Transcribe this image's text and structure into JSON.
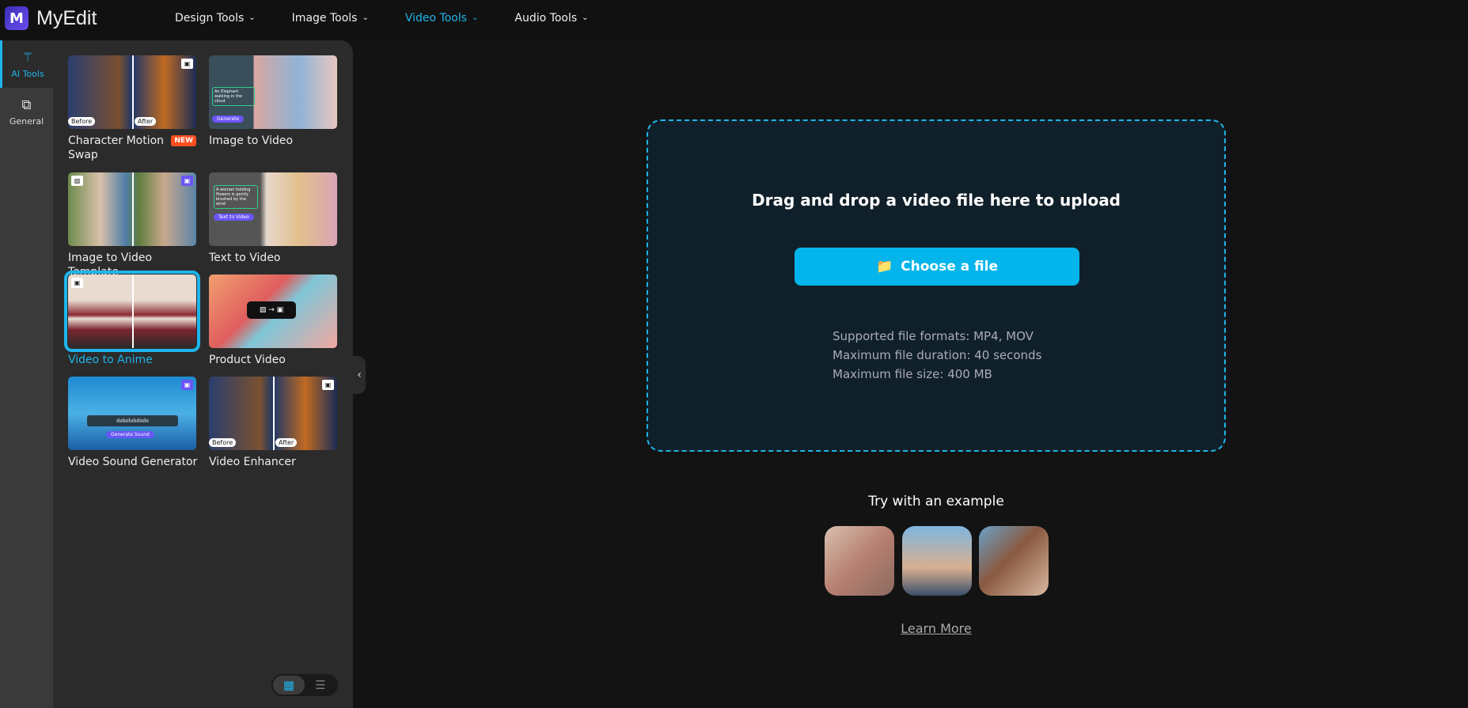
{
  "app": {
    "logo_letter": "M",
    "name": "MyEdit"
  },
  "nav": [
    {
      "label": "Design Tools"
    },
    {
      "label": "Image Tools"
    },
    {
      "label": "Video Tools",
      "active": true
    },
    {
      "label": "Audio Tools"
    }
  ],
  "rail": [
    {
      "label": "AI Tools",
      "icon": "magic-wand-icon",
      "active": true
    },
    {
      "label": "General",
      "icon": "layers-icon"
    }
  ],
  "tools": [
    {
      "title": "Character Motion Swap",
      "badge": "NEW",
      "tags": [
        "Before",
        "After"
      ]
    },
    {
      "title": "Image to Video",
      "overlay": "An Elephant walking in the cloud",
      "button": "Generate"
    },
    {
      "title": "Image to Video Template"
    },
    {
      "title": "Text to Video",
      "overlay": "A woman holding flowers is gently brushed by the wind",
      "button": "Text to Video"
    },
    {
      "title": "Video to Anime",
      "selected": true
    },
    {
      "title": "Product Video"
    },
    {
      "title": "Video Sound Generator",
      "button": "Generate Sound"
    },
    {
      "title": "Video Enhancer",
      "tags": [
        "Before",
        "After"
      ]
    }
  ],
  "upload": {
    "title": "Drag and drop a video file here to upload",
    "button": "Choose a file",
    "info": [
      "Supported file formats: MP4, MOV",
      "Maximum file duration: 40 seconds",
      "Maximum file size: 400 MB"
    ]
  },
  "examples": {
    "title": "Try with an example",
    "count": 3
  },
  "learn_more": "Learn More",
  "colors": {
    "accent": "#1fb5ea",
    "button": "#03b5eb",
    "badge": "#ff4d1f"
  }
}
